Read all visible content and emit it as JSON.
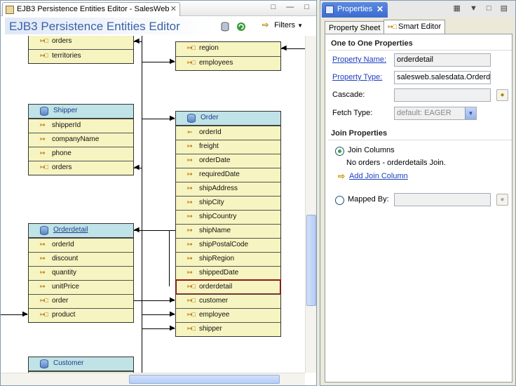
{
  "editor": {
    "tab_title": "EJB3 Persistence Entities Editor - SalesWeb",
    "tab_close": "✕",
    "window_buttons": "□ — □",
    "banner_title": "EJB3 Persistence Entities Editor",
    "filters_label": "Filters",
    "filters_arrow": "▼"
  },
  "diagram": {
    "top_left": {
      "rows": [
        "orders",
        "territories"
      ]
    },
    "top_right": {
      "rows": [
        "region",
        "employees"
      ]
    },
    "shipper": {
      "name": "Shipper",
      "rows": [
        "shipperId",
        "companyName",
        "phone",
        "orders"
      ]
    },
    "order": {
      "name": "Order",
      "rows": [
        "orderId",
        "freight",
        "orderDate",
        "requiredDate",
        "shipAddress",
        "shipCity",
        "shipCountry",
        "shipName",
        "shipPostalCode",
        "shipRegion",
        "shippedDate",
        "orderdetail",
        "customer",
        "employee",
        "shipper"
      ],
      "selected_row": "orderdetail"
    },
    "orderdetail": {
      "name": "Orderdetail",
      "rows": [
        "orderId",
        "discount",
        "quantity",
        "unitPrice",
        "order",
        "product"
      ]
    },
    "customer": {
      "name": "Customer",
      "rows": []
    }
  },
  "properties": {
    "tab_label": "Properties",
    "tab_close": "✕",
    "subtab_sheet": "Property Sheet",
    "subtab_smart": "Smart Editor",
    "section_one_to_one": "One to One Properties",
    "property_name_label": "Property Name:",
    "property_name_value": "orderdetail",
    "property_type_label": "Property Type:",
    "property_type_value": "salesweb.salesdata.Orderdetail",
    "cascade_label": "Cascade:",
    "cascade_value": "",
    "fetch_type_label": "Fetch Type:",
    "fetch_type_value": "default: EAGER",
    "section_join": "Join Properties",
    "join_columns_label": "Join Columns",
    "join_note": "No orders - orderdetails Join.",
    "add_join_column": "Add Join Column",
    "mapped_by_label": "Mapped By:",
    "mapped_by_value": ""
  }
}
